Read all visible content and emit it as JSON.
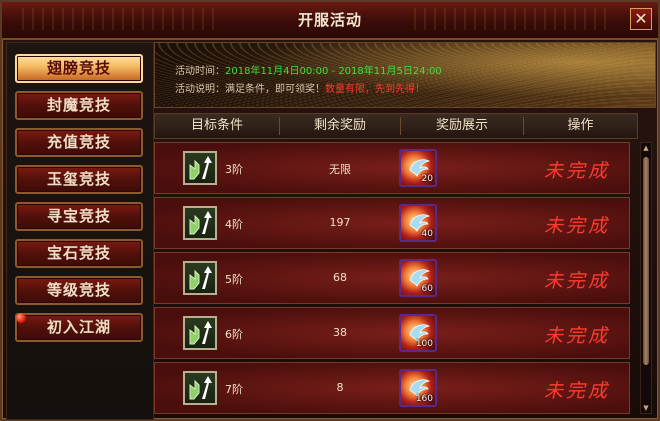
{
  "window": {
    "title": "开服活动",
    "close": "✕"
  },
  "sidebar": {
    "items": [
      {
        "label": "翅膀竞技",
        "active": true
      },
      {
        "label": "封魔竞技",
        "active": false
      },
      {
        "label": "充值竞技",
        "active": false
      },
      {
        "label": "玉玺竞技",
        "active": false
      },
      {
        "label": "寻宝竞技",
        "active": false
      },
      {
        "label": "宝石竞技",
        "active": false
      },
      {
        "label": "等级竞技",
        "active": false,
        "badge": true
      },
      {
        "label": "初入江湖",
        "active": false
      }
    ]
  },
  "banner": {
    "time_label": "活动时间：",
    "time_value": "2018年11月4日00:00 - 2018年11月5日24:00",
    "desc_label": "活动说明：满足条件，即可领奖！",
    "desc_warning": "数量有限，先到先得！"
  },
  "table": {
    "headers": [
      "目标条件",
      "剩余奖励",
      "奖励展示",
      "操作"
    ],
    "rows": [
      {
        "tier": "3阶",
        "remaining": "无限",
        "reward_count": "20",
        "status": "未完成"
      },
      {
        "tier": "4阶",
        "remaining": "197",
        "reward_count": "40",
        "status": "未完成"
      },
      {
        "tier": "5阶",
        "remaining": "68",
        "reward_count": "60",
        "status": "未完成"
      },
      {
        "tier": "6阶",
        "remaining": "38",
        "reward_count": "100",
        "status": "未完成"
      },
      {
        "tier": "7阶",
        "remaining": "8",
        "reward_count": "160",
        "status": "未完成"
      }
    ]
  },
  "colors": {
    "accent_red": "#ff3a30",
    "time_green": "#3ee03a",
    "active_tab": "#f3b760"
  }
}
